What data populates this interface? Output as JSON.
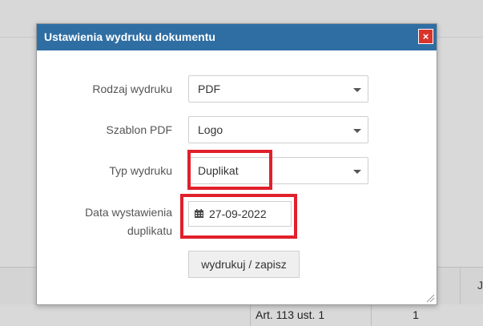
{
  "background": {
    "cells": [
      "Art. 113 ust. 1",
      "1"
    ],
    "edge_glyph": "J"
  },
  "modal": {
    "title": "Ustawienia wydruku dokumentu",
    "close_label": "×",
    "fields": {
      "print_type": {
        "label": "Rodzaj wydruku",
        "value": "PDF"
      },
      "pdf_template": {
        "label": "Szablon PDF",
        "value": "Logo"
      },
      "print_mode": {
        "label": "Typ wydruku",
        "value": "Duplikat"
      },
      "duplicate_date": {
        "label_line1": "Data wystawienia",
        "label_line2": "duplikatu",
        "value": "27-09-2022"
      }
    },
    "submit_label": "wydrukuj / zapisz"
  },
  "colors": {
    "titlebar": "#2f6ea3",
    "close": "#d9342b",
    "highlight": "#e0202b"
  }
}
